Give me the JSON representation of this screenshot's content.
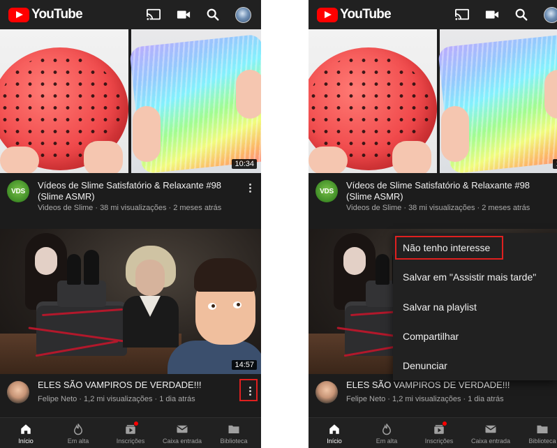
{
  "brand": {
    "name": "YouTube",
    "accent": "#ff0000"
  },
  "appbar_icons": [
    "cast-icon",
    "video-camera-icon",
    "search-icon",
    "account-avatar"
  ],
  "videos": [
    {
      "title": "Vídeos de Slime Satisfatório & Relaxante #98 (Slime ASMR)",
      "meta": "Videos de Slime · 38 mi visualizações · 2 meses atrás",
      "duration": "10:34",
      "channel_badge": "VDS"
    },
    {
      "title": "ELES SÃO VAMPIROS DE VERDADE!!!",
      "meta": "Felipe Neto · 1,2 mi visualizações · 1 dia atrás",
      "duration": "14:57"
    }
  ],
  "menu": {
    "items": [
      "Não tenho interesse",
      "Salvar em \"Assistir mais tarde\"",
      "Salvar na playlist",
      "Compartilhar",
      "Denunciar"
    ]
  },
  "nav": [
    {
      "label": "Início",
      "icon": "home-icon",
      "active": true
    },
    {
      "label": "Em alta",
      "icon": "flame-icon"
    },
    {
      "label": "Inscrições",
      "icon": "subscriptions-icon",
      "badge": true
    },
    {
      "label": "Caixa entrada",
      "icon": "mail-icon"
    },
    {
      "label": "Biblioteca",
      "icon": "folder-icon"
    }
  ],
  "colors": {
    "highlight": "#e0201f",
    "background": "#1c1c1c",
    "bar": "#212121"
  }
}
